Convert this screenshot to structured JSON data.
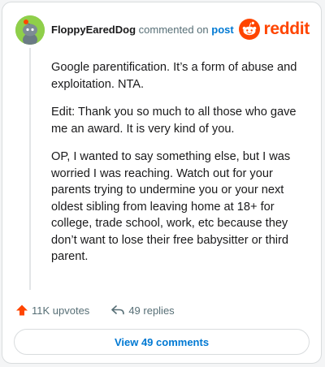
{
  "comment": {
    "author": "FloppyEaredDog",
    "action_text": "commented on",
    "post_link": "post",
    "paragraphs": [
      "Google parentification. It’s a form of abuse and exploitation. NTA.",
      "Edit: Thank you so much to all those who gave me an award. It is very kind of you.",
      "OP, I wanted to say something else, but I was worried I was reaching. Watch out for your parents trying to undermine you or your next oldest sibling from leaving home at 18+ for college, trade school, work, etc because they don’t want to lose their free babysitter or third parent."
    ]
  },
  "brand": {
    "name": "reddit",
    "icon": "reddit-snoo-icon",
    "color": "#ff4500"
  },
  "footer": {
    "upvotes": "11K upvotes",
    "upvote_icon": "upvote-arrow-icon",
    "replies": "49 replies",
    "reply_icon": "reply-arrow-icon"
  },
  "view_comments_label": "View 49 comments",
  "colors": {
    "accent": "#0079d3",
    "upvote": "#ff4500",
    "avatar_bg": "#8fcf4a"
  }
}
